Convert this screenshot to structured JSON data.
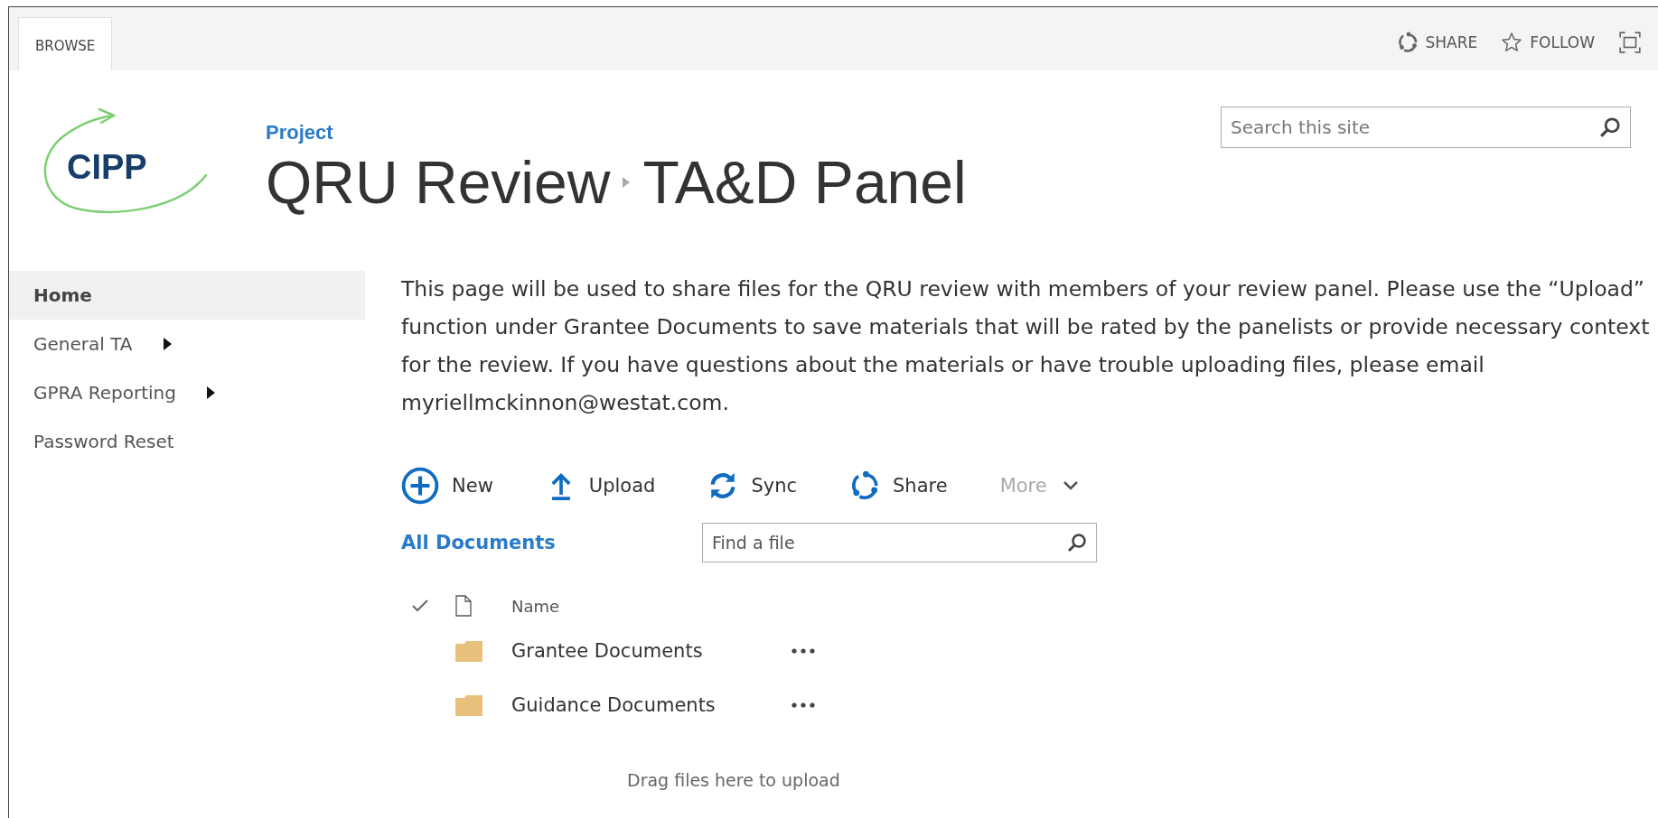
{
  "ribbon": {
    "tabs": [
      {
        "label": "BROWSE",
        "selected": true
      }
    ],
    "actions": [
      {
        "label": "SHARE"
      },
      {
        "label": "FOLLOW"
      }
    ]
  },
  "site": {
    "logo_text": "CIPP",
    "parent_link": "Project",
    "breadcrumb": [
      "QRU Review",
      "TA&D Panel"
    ]
  },
  "search": {
    "placeholder": "Search this site"
  },
  "nav": [
    {
      "label": "Home",
      "selected": true,
      "has_children": false
    },
    {
      "label": "General TA",
      "selected": false,
      "has_children": true
    },
    {
      "label": "GPRA Reporting",
      "selected": false,
      "has_children": true
    },
    {
      "label": "Password Reset",
      "selected": false,
      "has_children": false
    }
  ],
  "intro": "This page will be used to share files for the QRU review with members of your review panel. Please use the “Upload” function under Grantee Documents to save materials that will be rated by the panelists or provide necessary context for the review. If you have questions about the materials or have trouble uploading files, please email myriellmckinnon@westat.com.",
  "toolbar": [
    {
      "label": "New",
      "disabled": false
    },
    {
      "label": "Upload",
      "disabled": false
    },
    {
      "label": "Sync",
      "disabled": false
    },
    {
      "label": "Share",
      "disabled": false
    },
    {
      "label": "More",
      "disabled": true
    }
  ],
  "view": {
    "label": "All Documents"
  },
  "find": {
    "placeholder": "Find a file"
  },
  "list": {
    "columns": [
      "Name"
    ],
    "rows": [
      {
        "name": "Grantee Documents",
        "kind": "folder"
      },
      {
        "name": "Guidance Documents",
        "kind": "folder"
      }
    ]
  },
  "drop_hint": "Drag files here to upload"
}
